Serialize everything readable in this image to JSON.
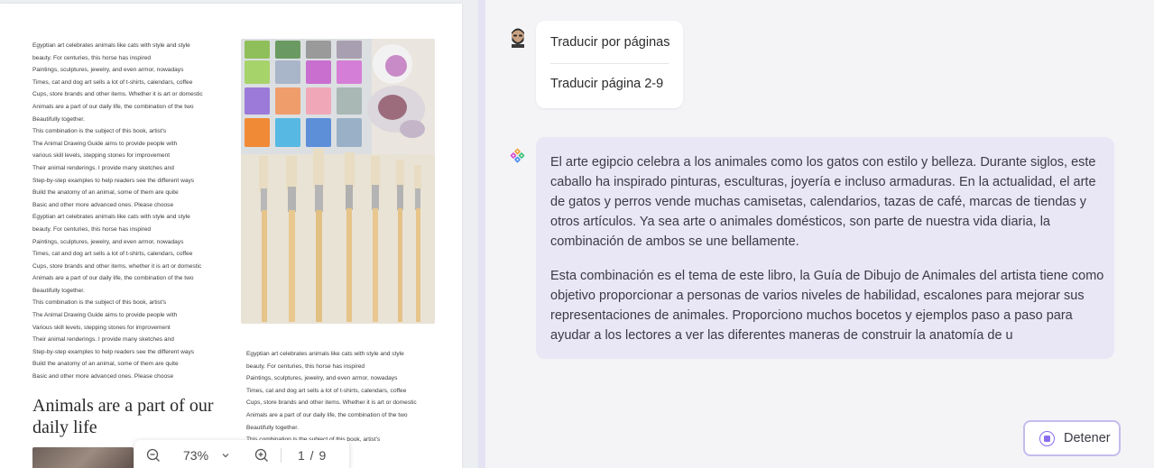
{
  "document": {
    "left_column": [
      "Egyptian art celebrates animals like cats with style and style",
      "beauty. For centuries, this horse has inspired",
      "Paintings, sculptures, jewelry, and even armor, nowadays",
      "Times, cat and dog art sells a lot of t-shirts, calendars, coffee",
      "Cups, store brands and other items. Whether it is art or domestic",
      "Animals are a part of our daily life, the combination of the two",
      "Beautifully together.",
      "This combination is the subject of this book, artist's",
      "The Animal Drawing Guide aims to provide people with",
      "various skill levels, stepping stones for improvement",
      "Their animal renderings. I provide many sketches and",
      "Step-by-step examples to help readers see the different ways",
      "Build the anatomy of an animal, some of them are quite",
      "Basic and other more advanced ones. Please choose",
      "Egyptian art celebrates animals like cats with style and style",
      "beauty. For centuries, this horse has inspired",
      "Paintings, sculptures, jewelry, and even armor, nowadays",
      "Times, cat and dog art sells a lot of t-shirts, calendars, coffee",
      "Cups, store brands and other items, whether it is art or domestic",
      "Animals are a part of our daily life, the combination of the two",
      "Beautifully together.",
      "This combination is the subject of this book, artist's",
      "The Animal Drawing Guide aims to provide people with",
      "Various skill levels, stepping stones for improvement",
      "Their animal renderings. I provide many sketches and",
      "Step-by-step examples to help readers see the different ways",
      "Build the anatomy of an animal, some of them are quite",
      "Basic and other more advanced ones. Please choose"
    ],
    "heading": "Animals are a part of our daily life",
    "right_column": [
      "Egyptian art celebrates animals like cats with style and style",
      "beauty. For centuries, this horse has inspired",
      "Paintings, sculptures, jewelry, and even armor, nowadays",
      "Times, cat and dog art sells a lot of t-shirts, calendars, coffee",
      "Cups, store brands and other items. Whether it is art or domestic",
      "Animals are a part of our daily life, the combination of the two",
      "Beautifully together.",
      "This combination is the subject of this book, artist's",
      "o provide people with",
      "s for improvement"
    ]
  },
  "zoom_bar": {
    "zoom": "73%",
    "page": "1 / 9"
  },
  "chat": {
    "user_options": [
      "Traducir por páginas",
      "Traducir página 2-9"
    ],
    "ai_lines_p1": [
      "El arte egipcio celebra a los animales como los gatos con estilo y belleza. Durante siglos, este",
      "caballo ha inspirado pinturas, esculturas, joyería e incluso armaduras. En la actualidad, el arte",
      "de gatos y perros vende muchas camisetas, calendarios, tazas de café, marcas de tiendas y",
      "otros artículos. Ya sea arte o animales domésticos, son parte de nuestra vida diaria, la",
      "combinación de ambos se une bellamente."
    ],
    "ai_lines_p2": [
      "Esta combinación es el tema de este libro, la Guía de Dibujo de Animales del artista tiene como",
      "objetivo proporcionar a personas de varios niveles de habilidad, escalones para mejorar sus",
      "representaciones de animales. Proporciono muchos bocetos y ejemplos paso a paso para",
      "ayudar a los lectores a ver las diferentes maneras de construir la anatomía de u"
    ],
    "stop_label": "Detener"
  },
  "colors": {
    "accent": "#8a6cf0",
    "ai_bubble": "#e9e6f6",
    "stop_border": "#c4bcec"
  },
  "icons": [
    "zoom-out-icon",
    "chevron-down-icon",
    "zoom-in-icon",
    "user-avatar-icon",
    "ai-logo-icon",
    "stop-icon"
  ]
}
